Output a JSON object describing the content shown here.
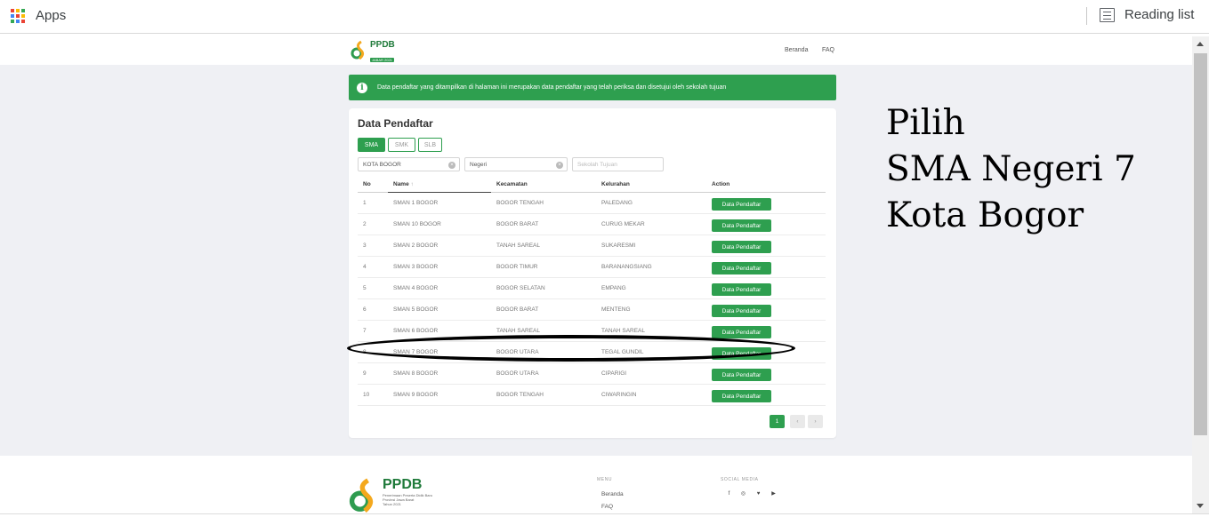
{
  "browser": {
    "apps_label": "Apps",
    "reading_list_label": "Reading list",
    "apps_colors": [
      "#ea4335",
      "#fbbc04",
      "#34a853",
      "#4285f4",
      "#ea4335",
      "#fbbc04",
      "#34a853",
      "#4285f4",
      "#ea4335"
    ]
  },
  "header": {
    "logo_text": "PPDB",
    "logo_badge": "JABAR 2021",
    "nav": [
      "Beranda",
      "FAQ"
    ]
  },
  "alert": {
    "text": "Data pendaftar yang ditampilkan di halaman ini merupakan data pendaftar yang telah periksa dan disetujui oleh sekolah tujuan"
  },
  "card": {
    "title": "Data Pendaftar",
    "tabs": [
      "SMA",
      "SMK",
      "SLB"
    ],
    "active_tab": "SMA",
    "filters": {
      "city": "KOTA BOGOR",
      "status": "Negeri",
      "school_placeholder": "Sekolah Tujuan"
    },
    "columns": [
      "No",
      "Name",
      "Kecamatan",
      "Kelurahan",
      "Action"
    ],
    "sort_indicator": "↑",
    "rows": [
      {
        "no": "1",
        "name": "SMAN 1 BOGOR",
        "kecamatan": "BOGOR TENGAH",
        "kelurahan": "PALEDANG",
        "action": "Data Pendaftar"
      },
      {
        "no": "2",
        "name": "SMAN 10 BOGOR",
        "kecamatan": "BOGOR BARAT",
        "kelurahan": "CURUG MEKAR",
        "action": "Data Pendaftar"
      },
      {
        "no": "3",
        "name": "SMAN 2 BOGOR",
        "kecamatan": "TANAH SAREAL",
        "kelurahan": "SUKARESMI",
        "action": "Data Pendaftar"
      },
      {
        "no": "4",
        "name": "SMAN 3 BOGOR",
        "kecamatan": "BOGOR TIMUR",
        "kelurahan": "BARANANGSIANG",
        "action": "Data Pendaftar"
      },
      {
        "no": "5",
        "name": "SMAN 4 BOGOR",
        "kecamatan": "BOGOR SELATAN",
        "kelurahan": "EMPANG",
        "action": "Data Pendaftar"
      },
      {
        "no": "6",
        "name": "SMAN 5 BOGOR",
        "kecamatan": "BOGOR BARAT",
        "kelurahan": "MENTENG",
        "action": "Data Pendaftar"
      },
      {
        "no": "7",
        "name": "SMAN 6 BOGOR",
        "kecamatan": "TANAH SAREAL",
        "kelurahan": "TANAH SAREAL",
        "action": "Data Pendaftar"
      },
      {
        "no": "8",
        "name": "SMAN 7 BOGOR",
        "kecamatan": "BOGOR UTARA",
        "kelurahan": "TEGAL GUNDIL",
        "action": "Data Pendaftar"
      },
      {
        "no": "9",
        "name": "SMAN 8 BOGOR",
        "kecamatan": "BOGOR UTARA",
        "kelurahan": "CIPARIGI",
        "action": "Data Pendaftar"
      },
      {
        "no": "10",
        "name": "SMAN 9 BOGOR",
        "kecamatan": "BOGOR TENGAH",
        "kelurahan": "CIWARINGIN",
        "action": "Data Pendaftar"
      }
    ],
    "pagination": {
      "current": "1",
      "prev": "‹",
      "next": "›"
    }
  },
  "annotation": {
    "lines": [
      "Pilih",
      "SMA Negeri 7",
      "Kota Bogor"
    ]
  },
  "footer": {
    "logo_text": "PPDB",
    "logo_sub": [
      "Penerimaan Peserta Didik Baru",
      "Provinsi Jawa Barat",
      "Tahun 2021"
    ],
    "menu_heading": "MENU",
    "menu_links": [
      "Beranda",
      "FAQ"
    ],
    "social_heading": "SOCIAL MEDIA",
    "social_icons": [
      "f",
      "◎",
      "♥",
      "▶"
    ]
  }
}
